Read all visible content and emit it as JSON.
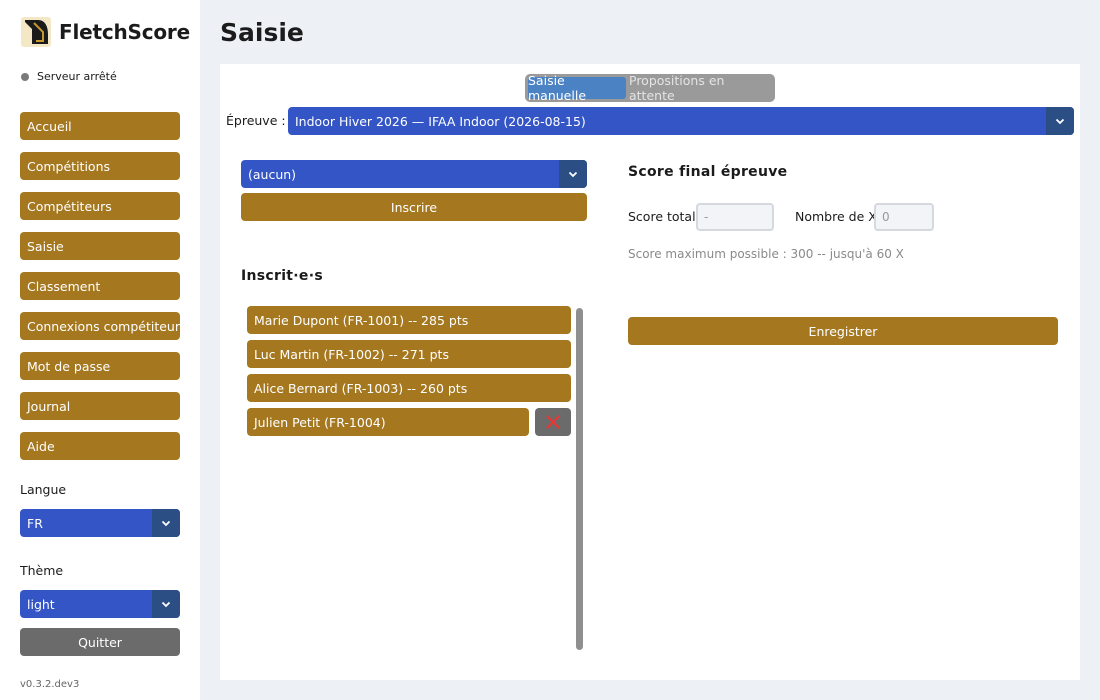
{
  "app": {
    "name": "FletchScore",
    "server_status": "Serveur arrêté",
    "version": "v0.3.2.dev3"
  },
  "sidebar": {
    "items": [
      {
        "label": "Accueil"
      },
      {
        "label": "Compétitions"
      },
      {
        "label": "Compétiteurs"
      },
      {
        "label": "Saisie"
      },
      {
        "label": "Classement"
      },
      {
        "label": "Connexions compétiteurs"
      },
      {
        "label": "Mot de passe"
      },
      {
        "label": "Journal"
      },
      {
        "label": "Aide"
      }
    ],
    "language_label": "Langue",
    "language_value": "FR",
    "theme_label": "Thème",
    "theme_value": "light",
    "quit_label": "Quitter"
  },
  "page": {
    "title": "Saisie",
    "tabs": [
      {
        "label": "Saisie manuelle",
        "active": true
      },
      {
        "label": "Propositions en attente",
        "active": false
      }
    ],
    "epreuve_label": "Épreuve :",
    "epreuve_value": "Indoor Hiver 2026 — IFAA Indoor (2026-08-15)",
    "competitor_select_value": "(aucun)",
    "inscrire_label": "Inscrire",
    "inscrits_title": "Inscrit·e·s",
    "inscrits": [
      {
        "label": "Marie Dupont (FR-1001) -- 285 pts",
        "deletable": false
      },
      {
        "label": "Luc Martin (FR-1002) -- 271 pts",
        "deletable": false
      },
      {
        "label": "Alice Bernard (FR-1003) -- 260 pts",
        "deletable": false
      },
      {
        "label": "Julien Petit (FR-1004)",
        "deletable": true
      }
    ],
    "final_title": "Score final épreuve",
    "score_total_label": "Score total",
    "score_total_placeholder": "-",
    "x_count_label": "Nombre de X",
    "x_count_placeholder": "0",
    "hint": "Score maximum possible : 300 -- jusqu'à 60 X",
    "save_label": "Enregistrer"
  },
  "colors": {
    "accent": "#a57820",
    "select": "#3355c6",
    "select_chevron": "#2b4f84",
    "neutral_button": "#6b6b6b",
    "delete_icon": "#e53935"
  },
  "icons": {
    "logo": "bow-logo-icon",
    "status": "status-dot-icon",
    "dropdown": "chevron-down-icon",
    "delete": "close-icon"
  }
}
